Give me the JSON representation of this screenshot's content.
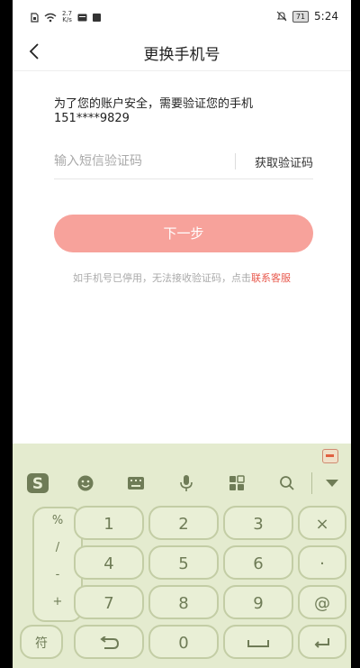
{
  "status_bar": {
    "net_speed_value": "2.7",
    "net_speed_unit": "K/s",
    "battery": "71",
    "time": "5:24"
  },
  "header": {
    "title": "更换手机号"
  },
  "content": {
    "notice_line1": "为了您的账户安全，需要验证您的手机",
    "notice_line2": "151****9829",
    "code_input_placeholder": "输入短信验证码",
    "get_code_label": "获取验证码",
    "next_button_label": "下一步",
    "hint_text": "如手机号已停用，无法接收验证码，点击",
    "hint_link": "联系客服"
  },
  "keyboard": {
    "symbols": [
      "%",
      "/",
      "-",
      "+"
    ],
    "digits": [
      "1",
      "2",
      "3",
      "4",
      "5",
      "6",
      "7",
      "8",
      "9",
      "0"
    ],
    "delete_key": "×",
    "dot_key": "·",
    "at_key": "@",
    "symbol_switch": "符",
    "colors": {
      "background": "#e4ebcf",
      "key_text": "#6f7c57"
    }
  },
  "colors": {
    "accent_button": "#f7a29b",
    "link": "#e8594d"
  }
}
